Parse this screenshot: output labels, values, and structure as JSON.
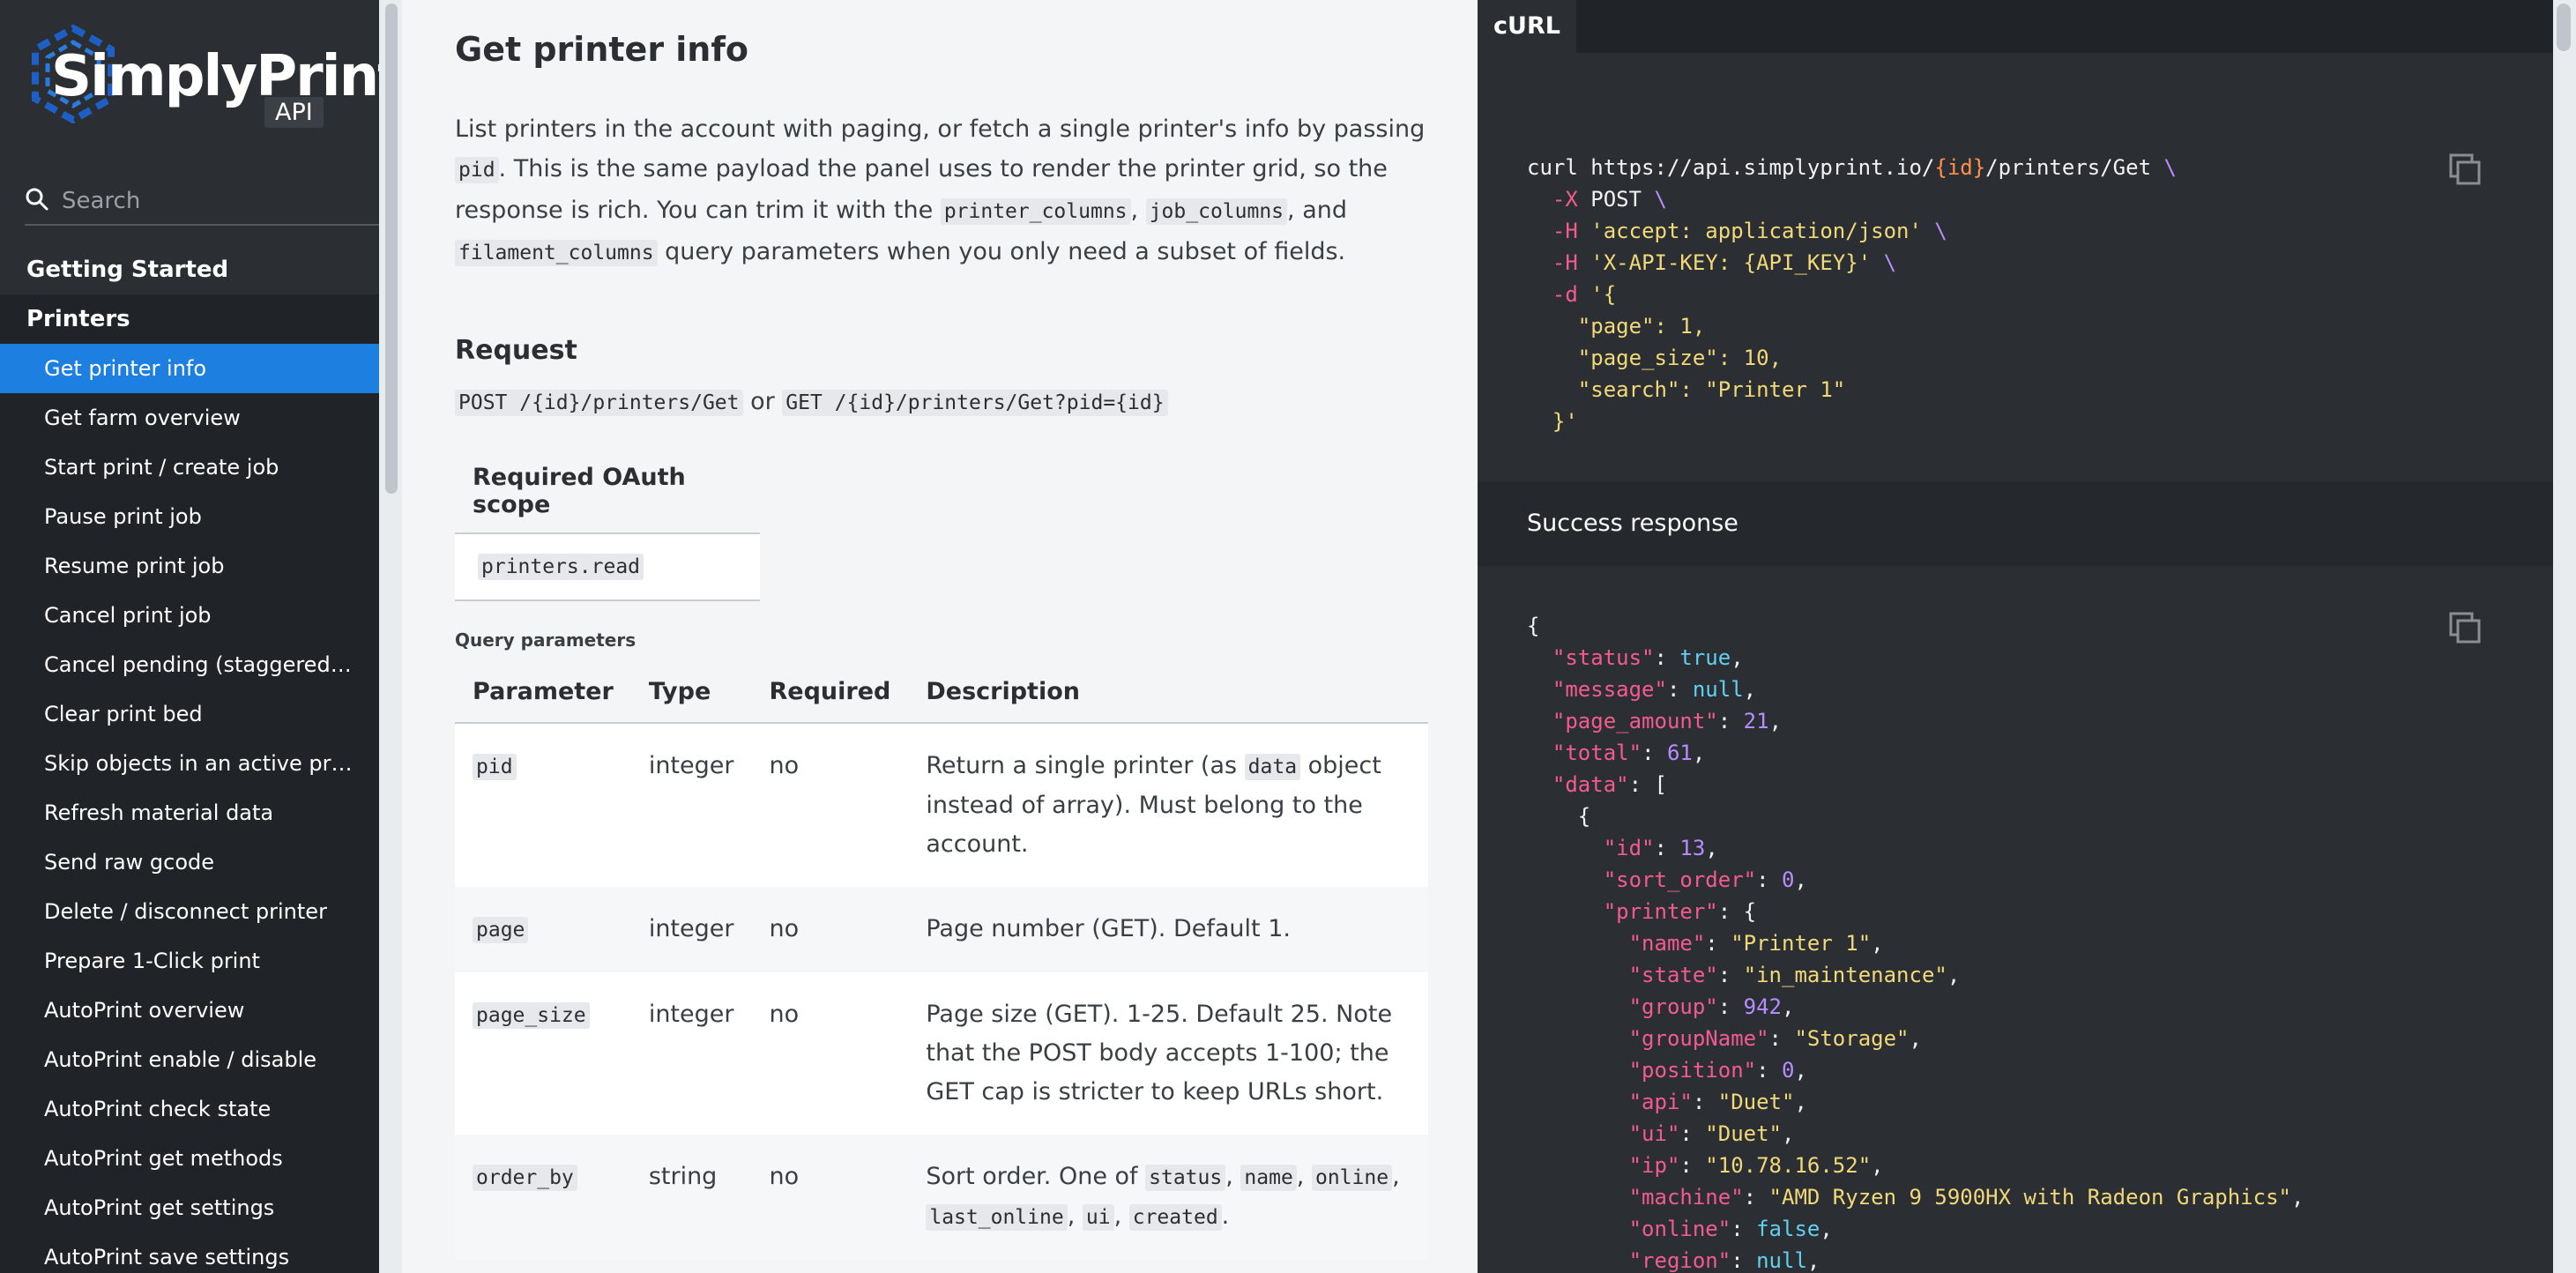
{
  "brand": {
    "name": "SimplyPrint",
    "badge": "API",
    "accent": "#1d7fe0"
  },
  "search": {
    "placeholder": "Search"
  },
  "nav": {
    "sections": [
      "Getting Started",
      "Printers"
    ],
    "items": [
      "Get printer info",
      "Get farm overview",
      "Start print / create job",
      "Pause print job",
      "Resume print job",
      "Cancel print job",
      "Cancel pending (staggered) ...",
      "Clear print bed",
      "Skip objects in an active print",
      "Refresh material data",
      "Send raw gcode",
      "Delete / disconnect printer",
      "Prepare 1-Click print",
      "AutoPrint overview",
      "AutoPrint enable / disable",
      "AutoPrint check state",
      "AutoPrint get methods",
      "AutoPrint get settings",
      "AutoPrint save settings"
    ],
    "active_index": 0
  },
  "main": {
    "title": "Get printer info",
    "intro": {
      "p1": "List printers in the account with paging, or fetch a single printer's info by passing ",
      "c1": "pid",
      "p2": ". This is the same payload the panel uses to render the printer grid, so the response is rich. You can trim it with the ",
      "c2": "printer_columns",
      "p3": ", ",
      "c3": "job_columns",
      "p4": ", and ",
      "c4": "filament_columns",
      "p5": " query parameters when you only need a subset of fields."
    },
    "request_heading": "Request",
    "endpoint": {
      "post": "POST /{id}/printers/Get",
      "or": " or ",
      "get": "GET /{id}/printers/Get?pid={id}"
    },
    "scope": {
      "header": "Required OAuth scope",
      "value": "printers.read"
    },
    "query_label": "Query parameters",
    "params_headers": [
      "Parameter",
      "Type",
      "Required",
      "Description"
    ],
    "params": [
      {
        "name": "pid",
        "type": "integer",
        "required": "no",
        "d1": "Return a single printer (as ",
        "dc": "data",
        "d2": " object instead of array). Must belong to the account."
      },
      {
        "name": "page",
        "type": "integer",
        "required": "no",
        "d1": "Page number (GET). Default 1.",
        "dc": "",
        "d2": ""
      },
      {
        "name": "page_size",
        "type": "integer",
        "required": "no",
        "d1": "Page size (GET). 1-25. Default 25. Note that the POST body accepts 1-100; the GET cap is stricter to keep URLs short.",
        "dc": "",
        "d2": ""
      },
      {
        "name": "order_by",
        "type": "string",
        "required": "no",
        "d1": "Sort order. One of ",
        "codes": [
          "status",
          "name",
          "online",
          "last_online",
          "ui",
          "created"
        ]
      }
    ]
  },
  "code": {
    "tab": "cURL",
    "success_label": "Success response",
    "curl": {
      "cmd": "curl https://api.simplyprint.io/",
      "id": "{id}",
      "path": "/printers/Get",
      "x": "-X",
      "method": "POST",
      "h": "-H",
      "accept": "'accept: application/json'",
      "apikey": "'X-API-KEY: {API_KEY}'",
      "d": "-d",
      "open": "'{",
      "k_page": "\"page\"",
      "v_page": "1",
      "k_page_size": "\"page_size\"",
      "v_page_size": "10",
      "k_search": "\"search\"",
      "v_search": "\"Printer 1\"",
      "close": "}'"
    },
    "response": {
      "k_status": "\"status\"",
      "v_status": "true",
      "k_message": "\"message\"",
      "v_message": "null",
      "k_page_amount": "\"page_amount\"",
      "v_page_amount": "21",
      "k_total": "\"total\"",
      "v_total": "61",
      "k_data": "\"data\"",
      "k_id": "\"id\"",
      "v_id": "13",
      "k_sort_order": "\"sort_order\"",
      "v_sort_order": "0",
      "k_printer": "\"printer\"",
      "k_name": "\"name\"",
      "v_name": "\"Printer 1\"",
      "k_state": "\"state\"",
      "v_state": "\"in_maintenance\"",
      "k_group": "\"group\"",
      "v_group": "942",
      "k_groupName": "\"groupName\"",
      "v_groupName": "\"Storage\"",
      "k_position": "\"position\"",
      "v_position": "0",
      "k_api": "\"api\"",
      "v_api": "\"Duet\"",
      "k_ui": "\"ui\"",
      "v_ui": "\"Duet\"",
      "k_ip": "\"ip\"",
      "v_ip": "\"10.78.16.52\"",
      "k_machine": "\"machine\"",
      "v_machine": "\"AMD Ryzen 9 5900HX with Radeon Graphics\"",
      "k_online": "\"online\"",
      "v_online": "false",
      "k_region": "\"region\"",
      "v_region": "null"
    }
  }
}
